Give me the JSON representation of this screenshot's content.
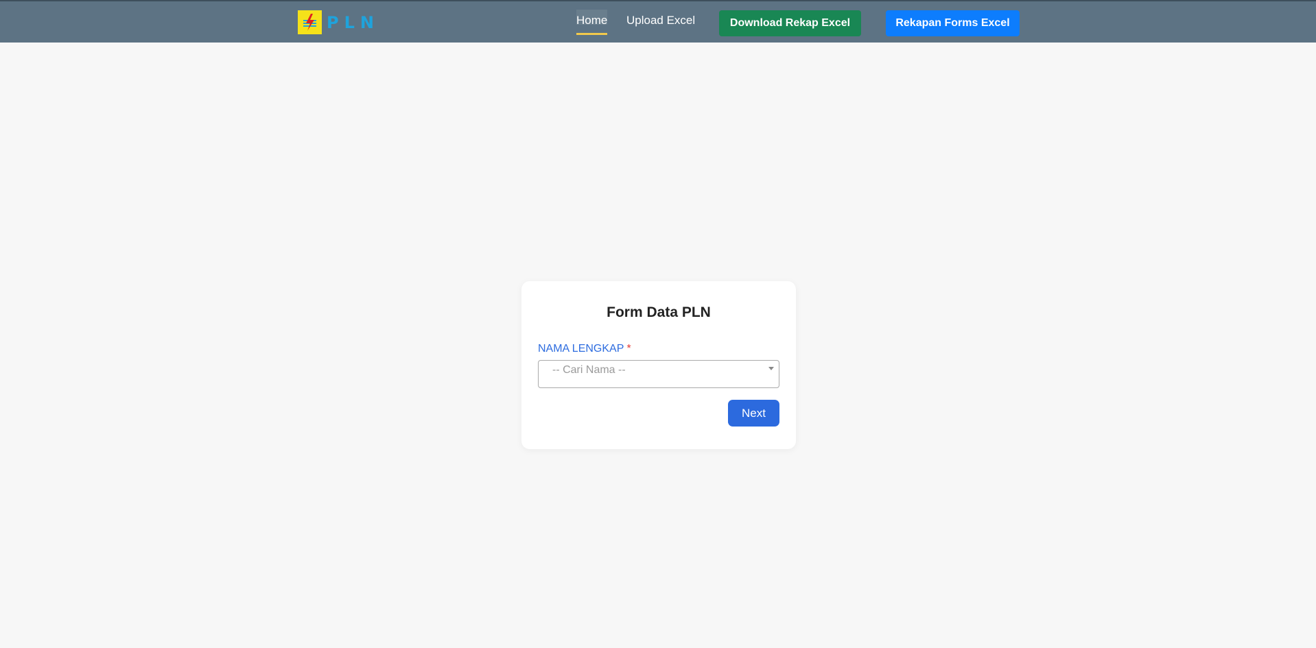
{
  "brand": {
    "name": "PLN",
    "logo_icon": "pln-lightning-logo",
    "logo_bg": "#f5e21a",
    "name_color": "#1fa3dc"
  },
  "nav": {
    "home_label": "Home",
    "upload_label": "Upload Excel",
    "active": "Home"
  },
  "actions": {
    "download_label": "Download Rekap Excel",
    "download_color": "#198754",
    "rekapan_label": "Rekapan Forms Excel",
    "rekapan_color": "#0d7dfd"
  },
  "form": {
    "title": "Form Data PLN",
    "name_label": "NAMA LENGKAP",
    "required_marker": "*",
    "name_placeholder": "-- Cari Nama --",
    "next_label": "Next"
  }
}
